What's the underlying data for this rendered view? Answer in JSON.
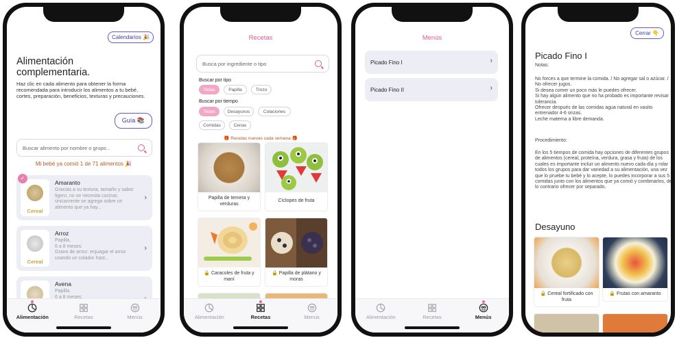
{
  "tabs": {
    "alimentacion": "Alimentación",
    "recetas": "Recetas",
    "menus": "Menús"
  },
  "screen1": {
    "calendarios_button": "Calendarios 🎉",
    "title": "Alimentación complementaria.",
    "description": "Haz clic en cada alimento para obtener la forma recomendada para introducir los alimentos a tu bebé, cortes, preparación, beneficios, texturas y precauciones.",
    "guia_button": "Guía 📚",
    "search_placeholder": "Buscar alimento por nombre o grupo...",
    "counter": "Mi bebé ya comió 1 de 71 alimentos 🎉",
    "foods": [
      {
        "name": "Amaranto",
        "category": "Cereal",
        "desc": "Gracias a su textura, tamaño y sabor ligero, no se necesita cocinar, únicamente se agrega sobre un alimento que ya hay..."
      },
      {
        "name": "Arroz",
        "category": "Cereal",
        "desc": "Papilla.\n6 a 8 meses:\nGrano de arroz: enjuagar el arroz usando un colador hast..."
      },
      {
        "name": "Avena",
        "category": "",
        "desc": "Papilla.\n6 a 8 meses:"
      }
    ]
  },
  "screen2": {
    "title": "Recetas",
    "search_placeholder": "Busca por ingrediente o tipo",
    "buscar_tipo": "Buscar por tipo",
    "tipo_chips": [
      "Todas",
      "Papilla",
      "Trozo"
    ],
    "buscar_tiempo": "Buscar por tiempo",
    "tiempo_chips": [
      "Todas",
      "Desayunos",
      "Colaciones",
      "Comidas",
      "Cenas"
    ],
    "weekly": "🎁 Recetas nuevas cada semana 🎁",
    "recipes": [
      "Papilla de ternera y verduras",
      "Cíclopes de fruta",
      "🔒 Caracoles de fruta y maní",
      "🔒 Papilla de plátano y moras"
    ]
  },
  "screen3": {
    "title": "Menús",
    "menus": [
      "Picado Fino I",
      "Picado Fino II"
    ]
  },
  "screen4": {
    "cerrar_button": "Cerrar 👇",
    "title": "Picado Fino I",
    "notas_label": "Notas:",
    "notas": "No forces a que termine la comida. / No agregar sal o azúcar. / No ofrecer jugos.\nSi desea comer un poco más le puedes ofrecer.\nSi hay algún alimento que no ha probado es importante revisar tolerancia.\nOfrecer después de las comidas agua natural en vasito entrenador 4-6 onzas.\nLeche materna a libre demanda.",
    "procedimiento_label": "Procedimiento:",
    "procedimiento": "En los 5 tiempos de comida hay opciones de diferentes grupos de alimentos (cereal, proteína, verdura, grasa y fruta) de los cuales es importante incluir un alimento nuevo cada día y rolar todos los grupos para dar variedad a su alimentación, una vez que lo pruebe tu bebé y lo acepte, lo puedes incorporar a sus 5 comidas junto con los alimentos que ya comió y combinarlos, de lo contrario ofrecer por separado.",
    "section": "Desayuno",
    "cards": [
      "🔒 Cereal fortificado con fruta",
      "🔒 Frutas con amaranto"
    ]
  }
}
